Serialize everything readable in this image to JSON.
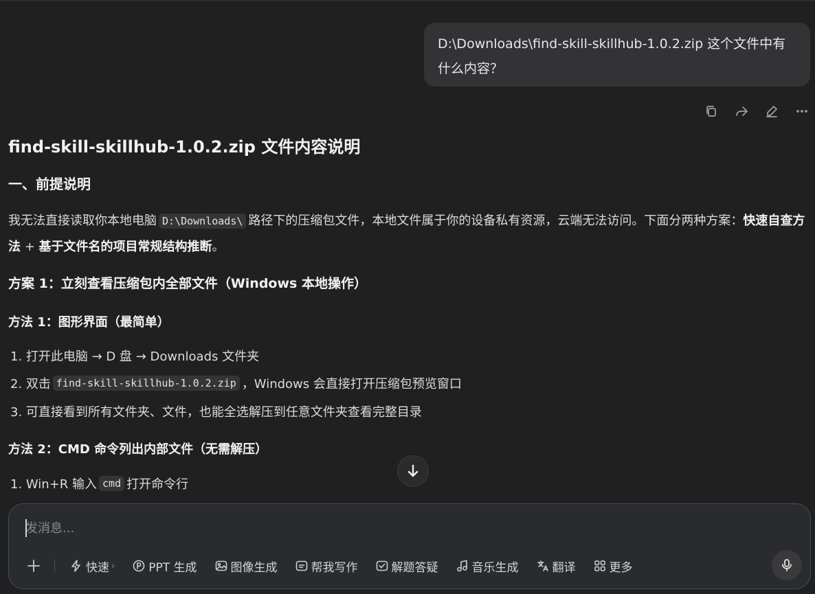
{
  "user_message": "D:\\Downloads\\find-skill-skillhub-1.0.2.zip 这个文件中有什么内容？",
  "message_actions": [
    "copy-icon",
    "share-icon",
    "edit-icon",
    "more-icon"
  ],
  "answer": {
    "title": "find-skill-skillhub-1.0.2.zip 文件内容说明",
    "section1_heading": "一、前提说明",
    "para_pre": "我无法直接读取你本地电脑",
    "para_code": "D:\\Downloads\\",
    "para_mid": "路径下的压缩包文件，本地文件属于你的设备私有资源，云端无法访问。下面分两种方案：",
    "para_bold1": "快速自查方法",
    "para_plus": " + ",
    "para_bold2": "基于文件名的项目常规结构推断",
    "para_end": "。",
    "plan1_heading": "方案 1：立刻查看压缩包内全部文件（Windows 本地操作）",
    "method1_heading": "方法 1：图形界面（最简单）",
    "m1_item1": "1. 打开此电脑 → D 盘 → Downloads 文件夹",
    "m1_item2_pre": "2. 双击",
    "m1_item2_code": "find-skill-skillhub-1.0.2.zip",
    "m1_item2_post": "，Windows 会直接打开压缩包预览窗口",
    "m1_item3": "3. 可直接看到所有文件夹、文件，也能全选解压到任意文件夹查看完整目录",
    "method2_heading": "方法 2：CMD 命令列出内部文件（无需解压）",
    "m2_item1_pre": "1. Win+R 输入",
    "m2_item1_code": "cmd",
    "m2_item1_post": "打开命令行"
  },
  "composer": {
    "placeholder": "发消息...",
    "tools": [
      {
        "icon": "lightning-icon",
        "label": "快速",
        "chevron": "›"
      },
      {
        "icon": "ppt-icon",
        "label": "PPT 生成"
      },
      {
        "icon": "image-icon",
        "label": "图像生成"
      },
      {
        "icon": "writing-icon",
        "label": "帮我写作"
      },
      {
        "icon": "solve-icon",
        "label": "解题答疑"
      },
      {
        "icon": "music-icon",
        "label": "音乐生成"
      },
      {
        "icon": "translate-icon",
        "label": "翻译"
      },
      {
        "icon": "grid-icon",
        "label": "更多"
      }
    ]
  },
  "colors": {
    "background": "#202020",
    "bubble": "#333335",
    "composer_border": "#3b5266"
  }
}
